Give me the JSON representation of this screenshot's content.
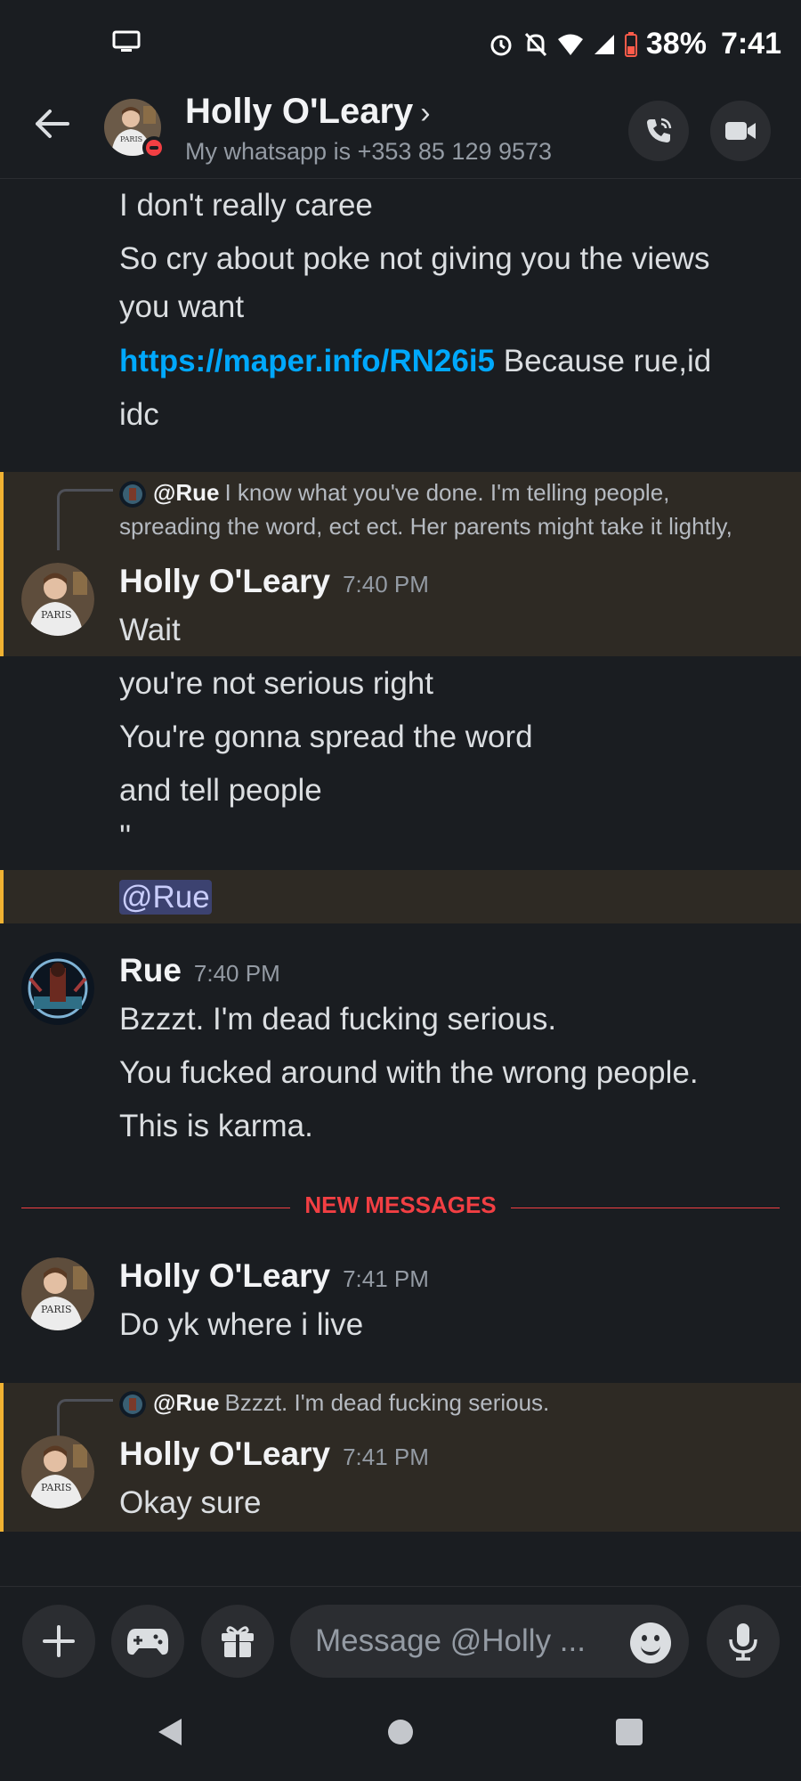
{
  "status_bar": {
    "battery": "38%",
    "time": "7:41"
  },
  "header": {
    "name": "Holly O'Leary",
    "chevron": "›",
    "status": "My whatsapp is +353 85 129 9573"
  },
  "messages": {
    "l1": "I don't really caree",
    "l2": "So cry about poke not giving you the views",
    "l3": "you want",
    "l4_link": "https://maper.info/RN26i5",
    "l4_rest": " Because rue,id",
    "l5": "idc",
    "reply1": {
      "who": "@Rue",
      "text1": "I know what you've done. I'm telling people,",
      "text2": "spreading the word, ect ect. Her parents might take it lightly,"
    },
    "group1": {
      "author": "Holly O'Leary",
      "time": "7:40 PM"
    },
    "g1_l1": "Wait",
    "g1_l2": "you're not serious right",
    "g1_l3": "You're gonna spread the word",
    "g1_l4": "and tell people",
    "g1_l5": "''",
    "g1_mention": "@Rue",
    "group2": {
      "author": "Rue",
      "time": "7:40 PM"
    },
    "g2_l1": "Bzzzt. I'm dead fucking serious.",
    "g2_l2": "You fucked around with the wrong people.",
    "g2_l3": "This is karma.",
    "divider": "NEW MESSAGES",
    "group3": {
      "author": "Holly O'Leary",
      "time": "7:41 PM"
    },
    "g3_l1": "Do yk where i live",
    "reply2": {
      "who": "@Rue",
      "text": "Bzzzt. I'm dead fucking serious."
    },
    "group4": {
      "author": "Holly O'Leary",
      "time": "7:41 PM"
    },
    "g4_l1": "Okay sure"
  },
  "composer": {
    "placeholder": "Message @Holly ..."
  },
  "icons": {
    "back": "arrow-left-icon",
    "call": "phone-icon",
    "video": "video-camera-icon",
    "add": "plus-icon",
    "games": "gamepad-icon",
    "gift": "gift-icon",
    "emoji": "smile-icon",
    "mic": "microphone-icon"
  },
  "colors": {
    "background": "#1a1d21",
    "link": "#00a8fc",
    "new_messages": "#f23f43",
    "highlight": "#2e2a24",
    "highlight_bar": "#f0b232"
  }
}
